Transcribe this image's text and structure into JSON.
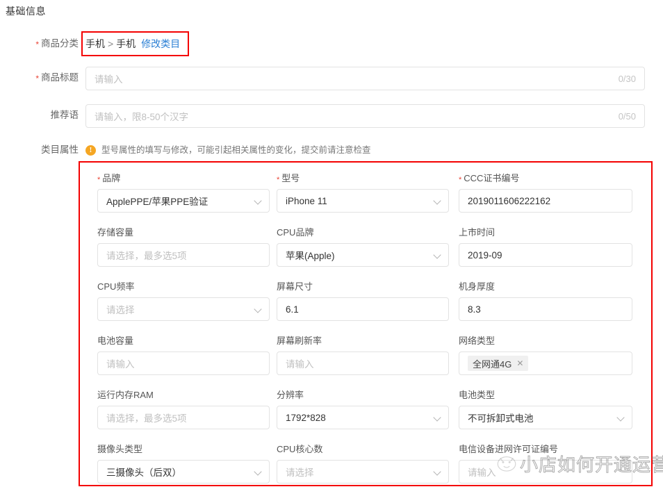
{
  "section": {
    "title": "基础信息"
  },
  "fields": {
    "category": {
      "label": "商品分类",
      "required": true,
      "path_part1": "手机",
      "separator": ">",
      "path_part2": "手机",
      "edit_link": "修改类目"
    },
    "title": {
      "label": "商品标题",
      "required": true,
      "placeholder": "请输入",
      "value": "",
      "counter": "0/30"
    },
    "slogan": {
      "label": "推荐语",
      "required": false,
      "placeholder": "请输入，限8-50个汉字",
      "value": "",
      "counter": "0/50"
    },
    "attributes_header": {
      "label": "类目属性",
      "warning_icon": "warning-icon",
      "warning_text": "型号属性的填写与修改，可能引起相关属性的变化，提交前请注意检查"
    }
  },
  "attributes": [
    [
      {
        "label": "品牌",
        "required": true,
        "value": "ApplePPE/苹果PPE验证",
        "placeholder": "",
        "control": "select",
        "name": "brand"
      },
      {
        "label": "型号",
        "required": true,
        "value": "iPhone 11",
        "placeholder": "",
        "control": "select",
        "name": "model"
      },
      {
        "label": "CCC证书编号",
        "required": true,
        "value": "2019011606222162",
        "placeholder": "",
        "control": "text",
        "name": "ccc-certificate-number"
      }
    ],
    [
      {
        "label": "存储容量",
        "required": false,
        "value": "",
        "placeholder": "请选择，最多选5项",
        "control": "text",
        "name": "storage-capacity"
      },
      {
        "label": "CPU品牌",
        "required": false,
        "value": "苹果(Apple)",
        "placeholder": "",
        "control": "select",
        "name": "cpu-brand"
      },
      {
        "label": "上市时间",
        "required": false,
        "value": "2019-09",
        "placeholder": "",
        "control": "text",
        "name": "release-date"
      }
    ],
    [
      {
        "label": "CPU频率",
        "required": false,
        "value": "",
        "placeholder": "请选择",
        "control": "select",
        "name": "cpu-frequency"
      },
      {
        "label": "屏幕尺寸",
        "required": false,
        "value": "6.1",
        "placeholder": "",
        "control": "text",
        "name": "screen-size"
      },
      {
        "label": "机身厚度",
        "required": false,
        "value": "8.3",
        "placeholder": "",
        "control": "text",
        "name": "body-thickness"
      }
    ],
    [
      {
        "label": "电池容量",
        "required": false,
        "value": "",
        "placeholder": "请输入",
        "control": "text",
        "name": "battery-capacity"
      },
      {
        "label": "屏幕刷新率",
        "required": false,
        "value": "",
        "placeholder": "请输入",
        "control": "text",
        "name": "screen-refresh-rate"
      },
      {
        "label": "网络类型",
        "required": false,
        "value": "",
        "placeholder": "",
        "control": "tag",
        "tag": "全网通4G",
        "tag_remove": "✕",
        "name": "network-type"
      }
    ],
    [
      {
        "label": "运行内存RAM",
        "required": false,
        "value": "",
        "placeholder": "请选择，最多选5项",
        "control": "text",
        "name": "ram"
      },
      {
        "label": "分辨率",
        "required": false,
        "value": "1792*828",
        "placeholder": "",
        "control": "select",
        "name": "resolution"
      },
      {
        "label": "电池类型",
        "required": false,
        "value": "不可拆卸式电池",
        "placeholder": "",
        "control": "select",
        "name": "battery-type"
      }
    ],
    [
      {
        "label": "摄像头类型",
        "required": false,
        "value": "三摄像头（后双）",
        "placeholder": "",
        "control": "select",
        "name": "camera-type"
      },
      {
        "label": "CPU核心数",
        "required": false,
        "value": "",
        "placeholder": "请选择",
        "control": "select",
        "name": "cpu-core-count"
      },
      {
        "label": "电信设备进网许可证编号",
        "required": false,
        "value": "",
        "placeholder": "请输入",
        "control": "text",
        "name": "telecom-license-number"
      }
    ]
  ],
  "watermark": {
    "text": "小店如何开通运营"
  },
  "colors": {
    "annotation_red": "#f40000",
    "link_blue": "#2a7fd4",
    "required_star": "#e94335",
    "warning_orange": "#f5a623"
  }
}
